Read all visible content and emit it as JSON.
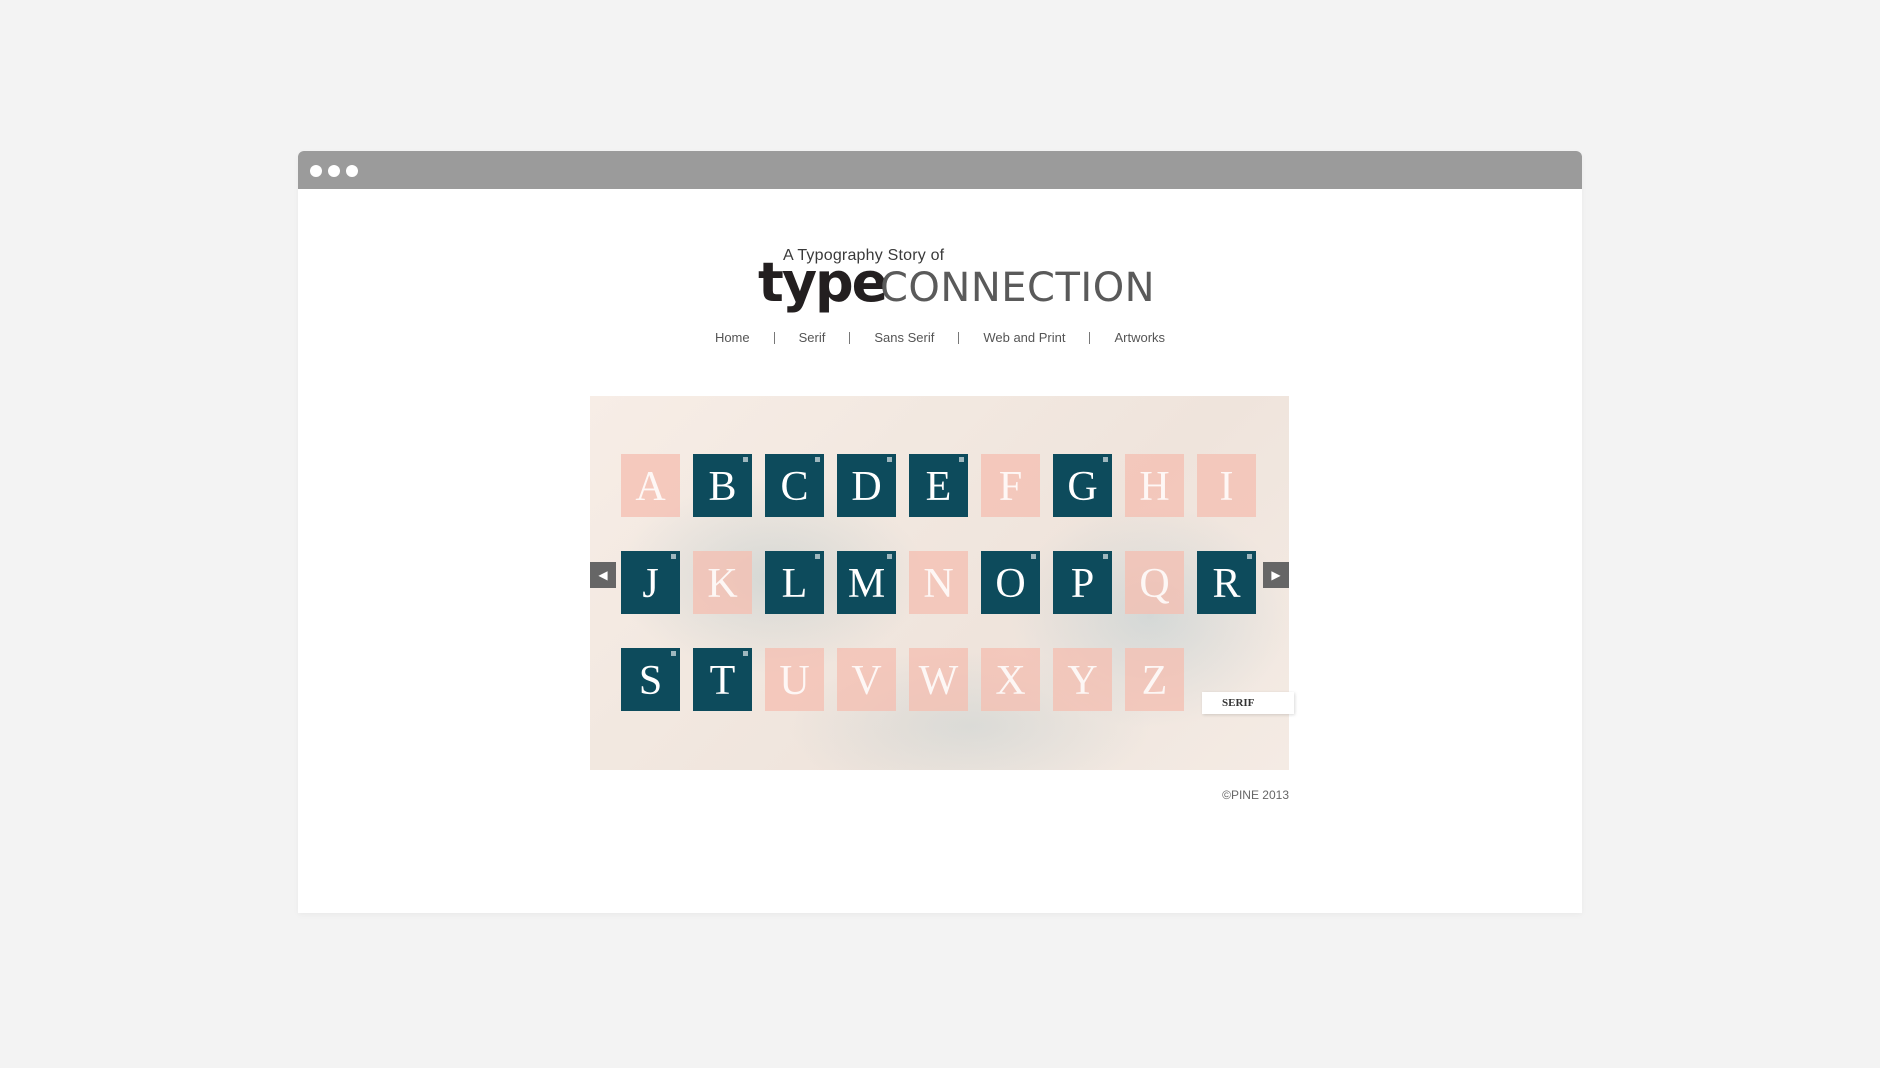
{
  "logo": {
    "tagline": "A Typography Story of",
    "word_bold": "type",
    "word_light": "CONNECTION"
  },
  "nav": [
    "Home",
    "Serif",
    "Sans Serif",
    "Web and Print",
    "Artworks"
  ],
  "tiles": [
    {
      "letter": "A",
      "active": false
    },
    {
      "letter": "B",
      "active": true
    },
    {
      "letter": "C",
      "active": true
    },
    {
      "letter": "D",
      "active": true
    },
    {
      "letter": "E",
      "active": true
    },
    {
      "letter": "F",
      "active": false
    },
    {
      "letter": "G",
      "active": true
    },
    {
      "letter": "H",
      "active": false
    },
    {
      "letter": "I",
      "active": false
    },
    {
      "letter": "J",
      "active": true
    },
    {
      "letter": "K",
      "active": false
    },
    {
      "letter": "L",
      "active": true
    },
    {
      "letter": "M",
      "active": true
    },
    {
      "letter": "N",
      "active": false
    },
    {
      "letter": "O",
      "active": true
    },
    {
      "letter": "P",
      "active": true
    },
    {
      "letter": "Q",
      "active": false
    },
    {
      "letter": "R",
      "active": true
    },
    {
      "letter": "S",
      "active": true
    },
    {
      "letter": "T",
      "active": true
    },
    {
      "letter": "U",
      "active": false
    },
    {
      "letter": "V",
      "active": false
    },
    {
      "letter": "W",
      "active": false
    },
    {
      "letter": "X",
      "active": false
    },
    {
      "letter": "Y",
      "active": false
    },
    {
      "letter": "Z",
      "active": false
    }
  ],
  "category_tag": "SERIF",
  "arrows": {
    "prev_icon": "prev-arrow-icon",
    "next_icon": "next-arrow-icon"
  },
  "copyright": "©PINE 2013",
  "colors": {
    "active_tile": "#0d4b5c",
    "inactive_tile": "#f4beb0",
    "titlebar": "#9b9b9b"
  }
}
